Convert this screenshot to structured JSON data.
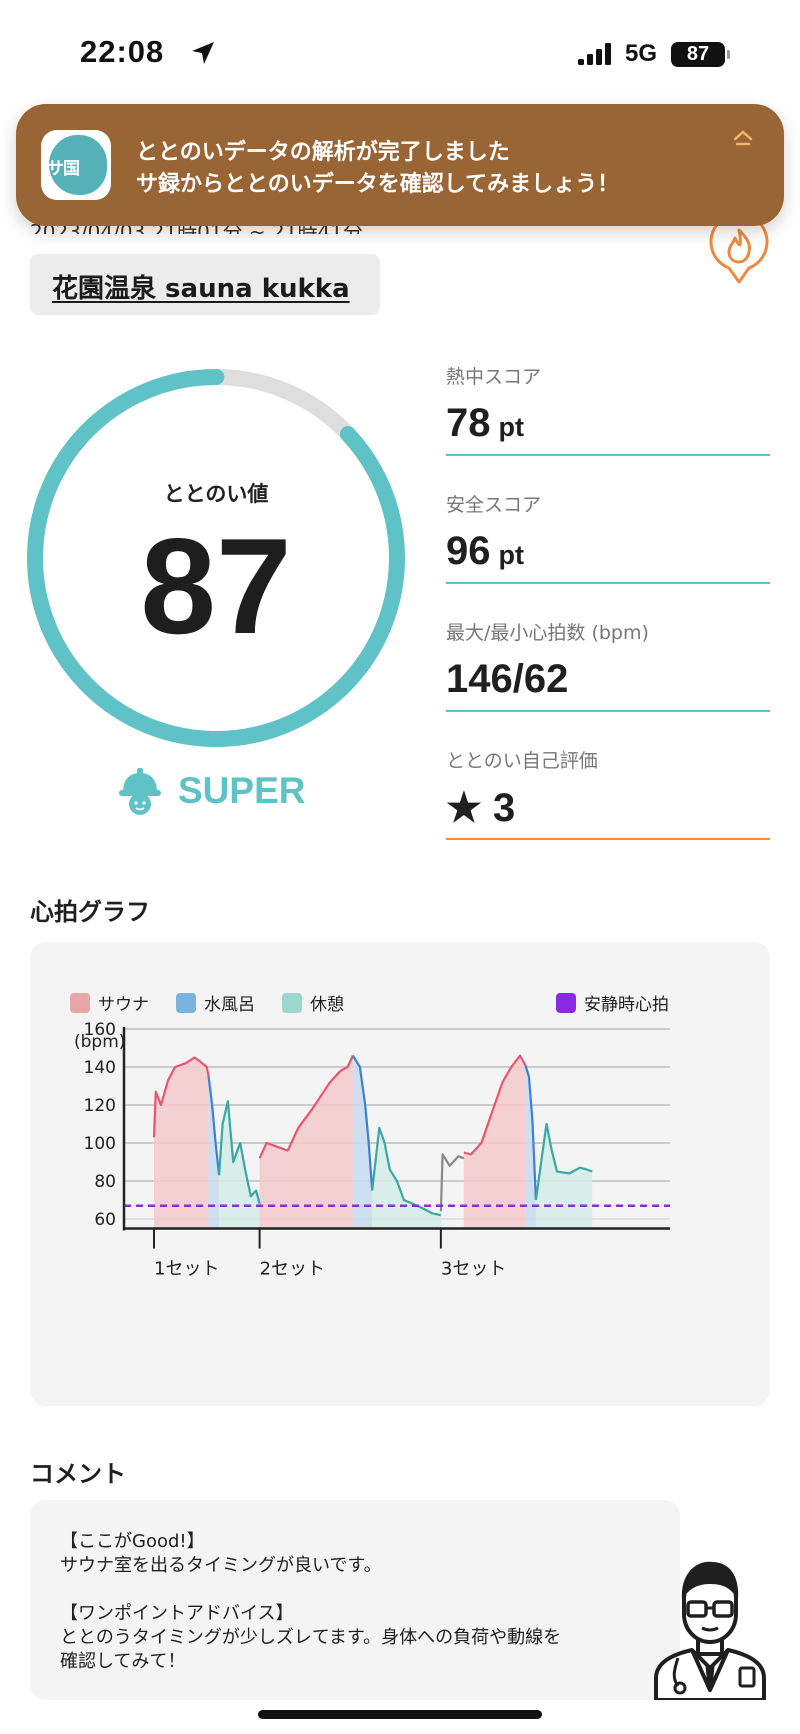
{
  "status_bar": {
    "time": "22:08",
    "network": "5G",
    "battery": "87"
  },
  "notification": {
    "app_icon_text": "サ国",
    "title": "ととのいデータの解析が完了しました",
    "body": "サ録からととのいデータを確認してみましょう！"
  },
  "session": {
    "date_partial": "2023/04/03 21時01分 ~ 21時41分",
    "place": "花園温泉 sauna kukka"
  },
  "score": {
    "label": "ととのい値",
    "value": "87",
    "ratio": 0.87,
    "grade": "SUPER"
  },
  "stats": [
    {
      "label": "熱中スコア",
      "value": "78",
      "unit": "pt"
    },
    {
      "label": "安全スコア",
      "value": "96",
      "unit": "pt"
    },
    {
      "label": "最大/最小心拍数 (bpm)",
      "value": "146/62",
      "unit": ""
    },
    {
      "label": "ととのい自己評価",
      "value": "★ 3",
      "unit": ""
    }
  ],
  "heart_graph": {
    "title": "心拍グラフ",
    "legend": [
      {
        "label": "サウナ",
        "color": "#e9a6a6"
      },
      {
        "label": "水風呂",
        "color": "#7ab4de"
      },
      {
        "label": "休憩",
        "color": "#9ed8cc"
      },
      {
        "label": "安静時心拍",
        "color": "#8a2be2"
      }
    ],
    "y_unit": "(bpm)",
    "y_ticks": [
      "160",
      "140",
      "120",
      "100",
      "80",
      "60"
    ],
    "set_labels": [
      "1セット",
      "2セット",
      "3セット"
    ]
  },
  "chart_data": {
    "type": "area",
    "title": "心拍グラフ",
    "ylabel": "(bpm)",
    "ylim": [
      55,
      160
    ],
    "y_ticks": [
      60,
      80,
      100,
      120,
      140,
      160
    ],
    "resting_heart_rate": 67,
    "x_unit": "minute",
    "x_range": [
      0,
      40
    ],
    "set_markers": [
      {
        "label": "1セット",
        "x": 1.6
      },
      {
        "label": "2セット",
        "x": 7.6
      },
      {
        "label": "3セット",
        "x": 17.9
      }
    ],
    "series": [
      {
        "name": "サウナ",
        "color": "#e9566b",
        "points": [
          [
            1.6,
            103
          ],
          [
            1.7,
            127
          ],
          [
            2.0,
            120
          ],
          [
            2.4,
            133
          ],
          [
            2.8,
            140
          ],
          [
            3.4,
            142
          ],
          [
            3.9,
            145
          ],
          [
            4.2,
            143
          ],
          [
            4.6,
            140
          ],
          [
            4.7,
            135
          ]
        ]
      },
      {
        "name": "水風呂",
        "color": "#3a80d9",
        "points": [
          [
            4.7,
            135
          ],
          [
            4.9,
            120
          ],
          [
            5.1,
            100
          ],
          [
            5.3,
            83
          ]
        ]
      },
      {
        "name": "休憩",
        "color": "#3aa7a3",
        "points": [
          [
            5.3,
            83
          ],
          [
            5.5,
            110
          ],
          [
            5.8,
            122
          ],
          [
            6.1,
            90
          ],
          [
            6.5,
            100
          ],
          [
            6.8,
            85
          ],
          [
            7.1,
            72
          ],
          [
            7.4,
            75
          ],
          [
            7.6,
            68
          ]
        ]
      },
      {
        "name": "サウナ",
        "color": "#e9566b",
        "points": [
          [
            7.6,
            92
          ],
          [
            8.0,
            100
          ],
          [
            8.6,
            98
          ],
          [
            9.2,
            96
          ],
          [
            9.8,
            108
          ],
          [
            10.6,
            118
          ],
          [
            11.6,
            132
          ],
          [
            12.2,
            138
          ],
          [
            12.6,
            140
          ],
          [
            12.9,
            146
          ]
        ]
      },
      {
        "name": "水風呂",
        "color": "#3a80d9",
        "points": [
          [
            12.9,
            146
          ],
          [
            13.3,
            140
          ],
          [
            13.6,
            120
          ],
          [
            13.8,
            100
          ],
          [
            14.0,
            75
          ]
        ]
      },
      {
        "name": "休憩",
        "color": "#3aa7a3",
        "points": [
          [
            14.0,
            75
          ],
          [
            14.4,
            108
          ],
          [
            14.7,
            100
          ],
          [
            15.0,
            86
          ],
          [
            15.4,
            80
          ],
          [
            15.8,
            70
          ],
          [
            16.3,
            68
          ],
          [
            16.8,
            66
          ],
          [
            17.4,
            63
          ],
          [
            17.9,
            62
          ]
        ]
      },
      {
        "name": "その他",
        "color": "#888888",
        "points": [
          [
            17.9,
            64
          ],
          [
            18.0,
            94
          ],
          [
            18.4,
            88
          ],
          [
            18.9,
            93
          ],
          [
            19.2,
            92
          ]
        ]
      },
      {
        "name": "サウナ",
        "color": "#e9566b",
        "points": [
          [
            19.2,
            95
          ],
          [
            19.6,
            94
          ],
          [
            20.2,
            100
          ],
          [
            20.8,
            116
          ],
          [
            21.4,
            132
          ],
          [
            21.9,
            140
          ],
          [
            22.4,
            146
          ],
          [
            22.7,
            141
          ]
        ]
      },
      {
        "name": "水風呂",
        "color": "#3a80d9",
        "points": [
          [
            22.7,
            141
          ],
          [
            22.9,
            135
          ],
          [
            23.1,
            112
          ],
          [
            23.3,
            70
          ]
        ]
      },
      {
        "name": "休憩",
        "color": "#3aa7a3",
        "points": [
          [
            23.3,
            70
          ],
          [
            23.6,
            90
          ],
          [
            23.9,
            110
          ],
          [
            24.2,
            96
          ],
          [
            24.5,
            85
          ],
          [
            25.2,
            84
          ],
          [
            25.8,
            87
          ],
          [
            26.2,
            86
          ],
          [
            26.5,
            85
          ]
        ]
      }
    ]
  },
  "comment": {
    "title": "コメント",
    "lines": [
      "【ここがGood!】",
      "サウナ室を出るタイミングが良いです。",
      "",
      "【ワンポイントアドバイス】",
      "ととのうタイミングが少しズレてます。身体への負荷や動線を",
      "確認してみて！"
    ]
  }
}
